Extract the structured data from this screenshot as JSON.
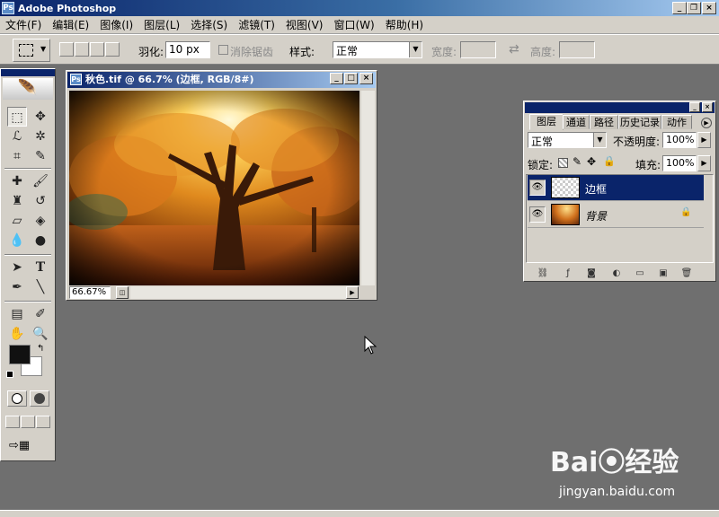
{
  "app": {
    "title": "Adobe Photoshop",
    "logo_text": "Ps",
    "window_buttons": [
      "_",
      "❐",
      "×"
    ]
  },
  "menu": [
    "文件(F)",
    "编辑(E)",
    "图像(I)",
    "图层(L)",
    "选择(S)",
    "滤镜(T)",
    "视图(V)",
    "窗口(W)",
    "帮助(H)"
  ],
  "options": {
    "feather_label": "羽化:",
    "feather_value": "10 px",
    "antialias_label": "消除锯齿",
    "style_label": "样式:",
    "style_value": "正常",
    "width_label": "宽度:",
    "height_label": "高度:",
    "swap_icon": "⇄"
  },
  "document": {
    "title": "秋色.tif @ 66.7% (边框, RGB/8#)",
    "zoom": "66.67%",
    "icon": "Ps"
  },
  "layers": {
    "tabs": [
      "图层",
      "通道",
      "路径",
      "历史记录",
      "动作"
    ],
    "blend_mode": "正常",
    "opacity_label": "不透明度:",
    "opacity_value": "100%",
    "lock_label": "锁定:",
    "fill_label": "填充:",
    "fill_value": "100%",
    "items": [
      {
        "name": "边框",
        "selected": true
      },
      {
        "name": "背景",
        "selected": false,
        "locked": true
      }
    ]
  },
  "watermark": {
    "brand": "Bai⦿经验",
    "url": "jingyan.baidu.com"
  },
  "colors": {
    "title_blue": "#0a246a",
    "chrome": "#d4d0c8",
    "workspace": "#6f6f6f"
  }
}
